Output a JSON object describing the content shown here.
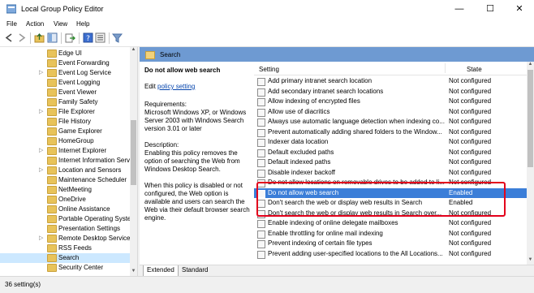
{
  "window": {
    "title": "Local Group Policy Editor",
    "min_glyph": "—",
    "max_glyph": "☐",
    "close_glyph": "✕"
  },
  "menu": {
    "items": [
      "File",
      "Action",
      "View",
      "Help"
    ]
  },
  "toolbar": {
    "icons": [
      "back-arrow-icon",
      "forward-arrow-icon",
      "up-folder-icon",
      "show-tree-icon",
      "export-list-icon",
      "help-icon",
      "properties-icon",
      "filter-icon"
    ]
  },
  "tree": {
    "items": [
      {
        "label": "Edge UI",
        "expandable": false
      },
      {
        "label": "Event Forwarding",
        "expandable": false
      },
      {
        "label": "Event Log Service",
        "expandable": true
      },
      {
        "label": "Event Logging",
        "expandable": false
      },
      {
        "label": "Event Viewer",
        "expandable": false
      },
      {
        "label": "Family Safety",
        "expandable": false
      },
      {
        "label": "File Explorer",
        "expandable": true
      },
      {
        "label": "File History",
        "expandable": false
      },
      {
        "label": "Game Explorer",
        "expandable": false
      },
      {
        "label": "HomeGroup",
        "expandable": false
      },
      {
        "label": "Internet Explorer",
        "expandable": true
      },
      {
        "label": "Internet Information Serv",
        "expandable": false
      },
      {
        "label": "Location and Sensors",
        "expandable": true
      },
      {
        "label": "Maintenance Scheduler",
        "expandable": false
      },
      {
        "label": "NetMeeting",
        "expandable": false
      },
      {
        "label": "OneDrive",
        "expandable": false
      },
      {
        "label": "Online Assistance",
        "expandable": false
      },
      {
        "label": "Portable Operating Syste",
        "expandable": false
      },
      {
        "label": "Presentation Settings",
        "expandable": false
      },
      {
        "label": "Remote Desktop Services",
        "expandable": true
      },
      {
        "label": "RSS Feeds",
        "expandable": false
      },
      {
        "label": "Search",
        "expandable": false,
        "selected": true
      },
      {
        "label": "Security Center",
        "expandable": false
      }
    ]
  },
  "right": {
    "header": "Search",
    "description": {
      "title": "Do not allow web search",
      "edit_prefix": "Edit",
      "edit_link": "policy setting",
      "requirements_label": "Requirements:",
      "requirements_text": "Microsoft Windows XP, or Windows Server 2003 with Windows Search version 3.01 or later",
      "description_label": "Description:",
      "description_text": "Enabling this policy removes the option of searching the Web from Windows Desktop Search.",
      "detail_text": "When this policy is disabled or not configured, the Web option is available and users can search the Web via their default browser search engine."
    },
    "columns": {
      "setting": "Setting",
      "state": "State"
    },
    "rows": [
      {
        "name": "Add primary intranet search location",
        "state": "Not configured"
      },
      {
        "name": "Add secondary intranet search locations",
        "state": "Not configured"
      },
      {
        "name": "Allow indexing of encrypted files",
        "state": "Not configured"
      },
      {
        "name": "Allow use of diacritics",
        "state": "Not configured"
      },
      {
        "name": "Always use automatic language detection when indexing co...",
        "state": "Not configured"
      },
      {
        "name": "Prevent automatically adding shared folders to the Window...",
        "state": "Not configured"
      },
      {
        "name": "Indexer data location",
        "state": "Not configured"
      },
      {
        "name": "Default excluded paths",
        "state": "Not configured"
      },
      {
        "name": "Default indexed paths",
        "state": "Not configured"
      },
      {
        "name": "Disable indexer backoff",
        "state": "Not configured"
      },
      {
        "name": "Do not allow locations on removable drives to be added to li...",
        "state": "Not configured"
      },
      {
        "name": "Do not allow web search",
        "state": "Enabled",
        "selected": true
      },
      {
        "name": "Don't search the web or display web results in Search",
        "state": "Enabled"
      },
      {
        "name": "Don't search the web or display web results in Search over...",
        "state": "Not configured"
      },
      {
        "name": "Enable indexing of online delegate mailboxes",
        "state": "Not configured"
      },
      {
        "name": "Enable throttling for online mail indexing",
        "state": "Not configured"
      },
      {
        "name": "Prevent indexing of certain file types",
        "state": "Not configured"
      },
      {
        "name": "Prevent adding user-specified locations to the All Locations...",
        "state": "Not configured"
      }
    ],
    "tabs": [
      "Extended",
      "Standard"
    ]
  },
  "status": "36 setting(s)",
  "colors": {
    "header_blue": "#6e9ad2",
    "selection_blue": "#3b7ed8",
    "highlight_box": "#e3001b"
  }
}
